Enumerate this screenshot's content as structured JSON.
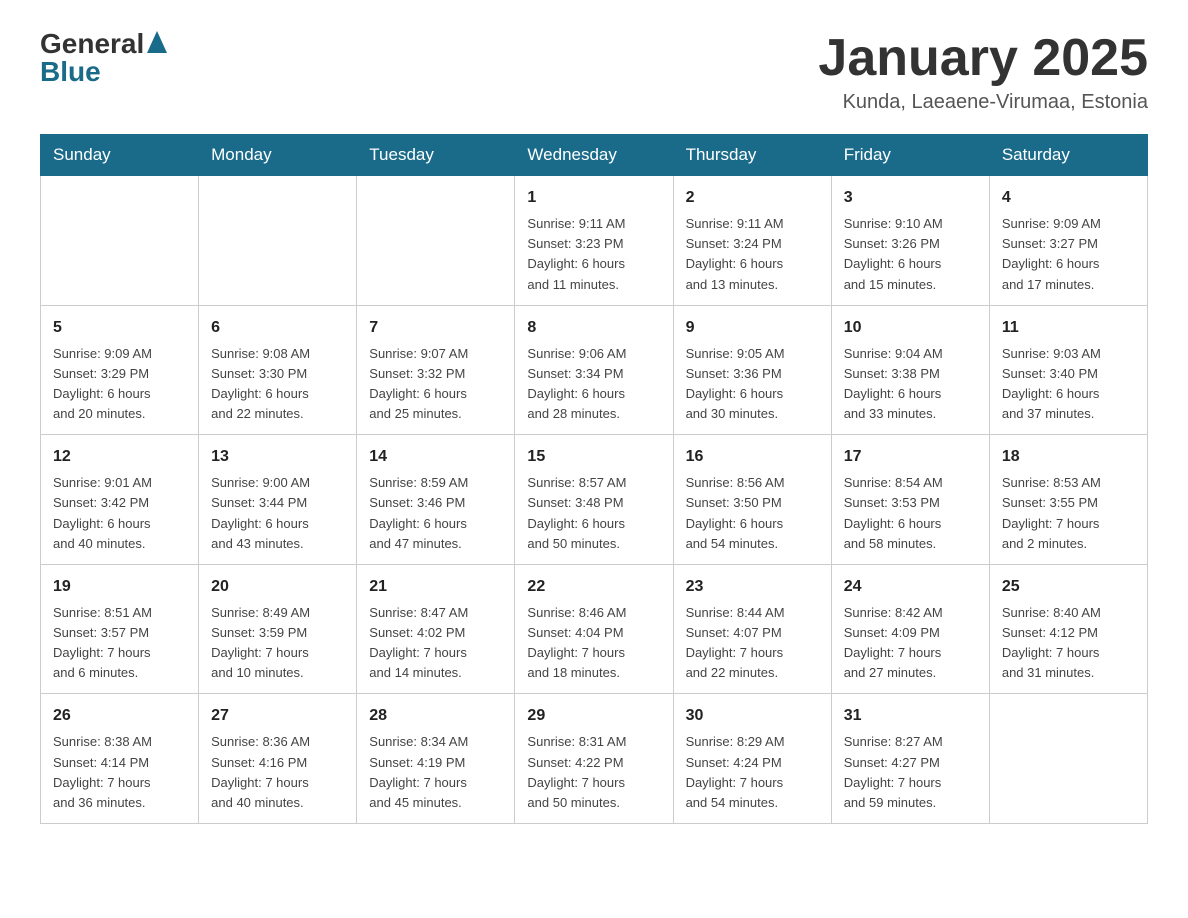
{
  "logo": {
    "general": "General",
    "blue": "Blue",
    "arrow": "▶"
  },
  "title": "January 2025",
  "subtitle": "Kunda, Laeaene-Virumaa, Estonia",
  "days_of_week": [
    "Sunday",
    "Monday",
    "Tuesday",
    "Wednesday",
    "Thursday",
    "Friday",
    "Saturday"
  ],
  "weeks": [
    [
      {
        "day": "",
        "info": ""
      },
      {
        "day": "",
        "info": ""
      },
      {
        "day": "",
        "info": ""
      },
      {
        "day": "1",
        "info": "Sunrise: 9:11 AM\nSunset: 3:23 PM\nDaylight: 6 hours\nand 11 minutes."
      },
      {
        "day": "2",
        "info": "Sunrise: 9:11 AM\nSunset: 3:24 PM\nDaylight: 6 hours\nand 13 minutes."
      },
      {
        "day": "3",
        "info": "Sunrise: 9:10 AM\nSunset: 3:26 PM\nDaylight: 6 hours\nand 15 minutes."
      },
      {
        "day": "4",
        "info": "Sunrise: 9:09 AM\nSunset: 3:27 PM\nDaylight: 6 hours\nand 17 minutes."
      }
    ],
    [
      {
        "day": "5",
        "info": "Sunrise: 9:09 AM\nSunset: 3:29 PM\nDaylight: 6 hours\nand 20 minutes."
      },
      {
        "day": "6",
        "info": "Sunrise: 9:08 AM\nSunset: 3:30 PM\nDaylight: 6 hours\nand 22 minutes."
      },
      {
        "day": "7",
        "info": "Sunrise: 9:07 AM\nSunset: 3:32 PM\nDaylight: 6 hours\nand 25 minutes."
      },
      {
        "day": "8",
        "info": "Sunrise: 9:06 AM\nSunset: 3:34 PM\nDaylight: 6 hours\nand 28 minutes."
      },
      {
        "day": "9",
        "info": "Sunrise: 9:05 AM\nSunset: 3:36 PM\nDaylight: 6 hours\nand 30 minutes."
      },
      {
        "day": "10",
        "info": "Sunrise: 9:04 AM\nSunset: 3:38 PM\nDaylight: 6 hours\nand 33 minutes."
      },
      {
        "day": "11",
        "info": "Sunrise: 9:03 AM\nSunset: 3:40 PM\nDaylight: 6 hours\nand 37 minutes."
      }
    ],
    [
      {
        "day": "12",
        "info": "Sunrise: 9:01 AM\nSunset: 3:42 PM\nDaylight: 6 hours\nand 40 minutes."
      },
      {
        "day": "13",
        "info": "Sunrise: 9:00 AM\nSunset: 3:44 PM\nDaylight: 6 hours\nand 43 minutes."
      },
      {
        "day": "14",
        "info": "Sunrise: 8:59 AM\nSunset: 3:46 PM\nDaylight: 6 hours\nand 47 minutes."
      },
      {
        "day": "15",
        "info": "Sunrise: 8:57 AM\nSunset: 3:48 PM\nDaylight: 6 hours\nand 50 minutes."
      },
      {
        "day": "16",
        "info": "Sunrise: 8:56 AM\nSunset: 3:50 PM\nDaylight: 6 hours\nand 54 minutes."
      },
      {
        "day": "17",
        "info": "Sunrise: 8:54 AM\nSunset: 3:53 PM\nDaylight: 6 hours\nand 58 minutes."
      },
      {
        "day": "18",
        "info": "Sunrise: 8:53 AM\nSunset: 3:55 PM\nDaylight: 7 hours\nand 2 minutes."
      }
    ],
    [
      {
        "day": "19",
        "info": "Sunrise: 8:51 AM\nSunset: 3:57 PM\nDaylight: 7 hours\nand 6 minutes."
      },
      {
        "day": "20",
        "info": "Sunrise: 8:49 AM\nSunset: 3:59 PM\nDaylight: 7 hours\nand 10 minutes."
      },
      {
        "day": "21",
        "info": "Sunrise: 8:47 AM\nSunset: 4:02 PM\nDaylight: 7 hours\nand 14 minutes."
      },
      {
        "day": "22",
        "info": "Sunrise: 8:46 AM\nSunset: 4:04 PM\nDaylight: 7 hours\nand 18 minutes."
      },
      {
        "day": "23",
        "info": "Sunrise: 8:44 AM\nSunset: 4:07 PM\nDaylight: 7 hours\nand 22 minutes."
      },
      {
        "day": "24",
        "info": "Sunrise: 8:42 AM\nSunset: 4:09 PM\nDaylight: 7 hours\nand 27 minutes."
      },
      {
        "day": "25",
        "info": "Sunrise: 8:40 AM\nSunset: 4:12 PM\nDaylight: 7 hours\nand 31 minutes."
      }
    ],
    [
      {
        "day": "26",
        "info": "Sunrise: 8:38 AM\nSunset: 4:14 PM\nDaylight: 7 hours\nand 36 minutes."
      },
      {
        "day": "27",
        "info": "Sunrise: 8:36 AM\nSunset: 4:16 PM\nDaylight: 7 hours\nand 40 minutes."
      },
      {
        "day": "28",
        "info": "Sunrise: 8:34 AM\nSunset: 4:19 PM\nDaylight: 7 hours\nand 45 minutes."
      },
      {
        "day": "29",
        "info": "Sunrise: 8:31 AM\nSunset: 4:22 PM\nDaylight: 7 hours\nand 50 minutes."
      },
      {
        "day": "30",
        "info": "Sunrise: 8:29 AM\nSunset: 4:24 PM\nDaylight: 7 hours\nand 54 minutes."
      },
      {
        "day": "31",
        "info": "Sunrise: 8:27 AM\nSunset: 4:27 PM\nDaylight: 7 hours\nand 59 minutes."
      },
      {
        "day": "",
        "info": ""
      }
    ]
  ]
}
